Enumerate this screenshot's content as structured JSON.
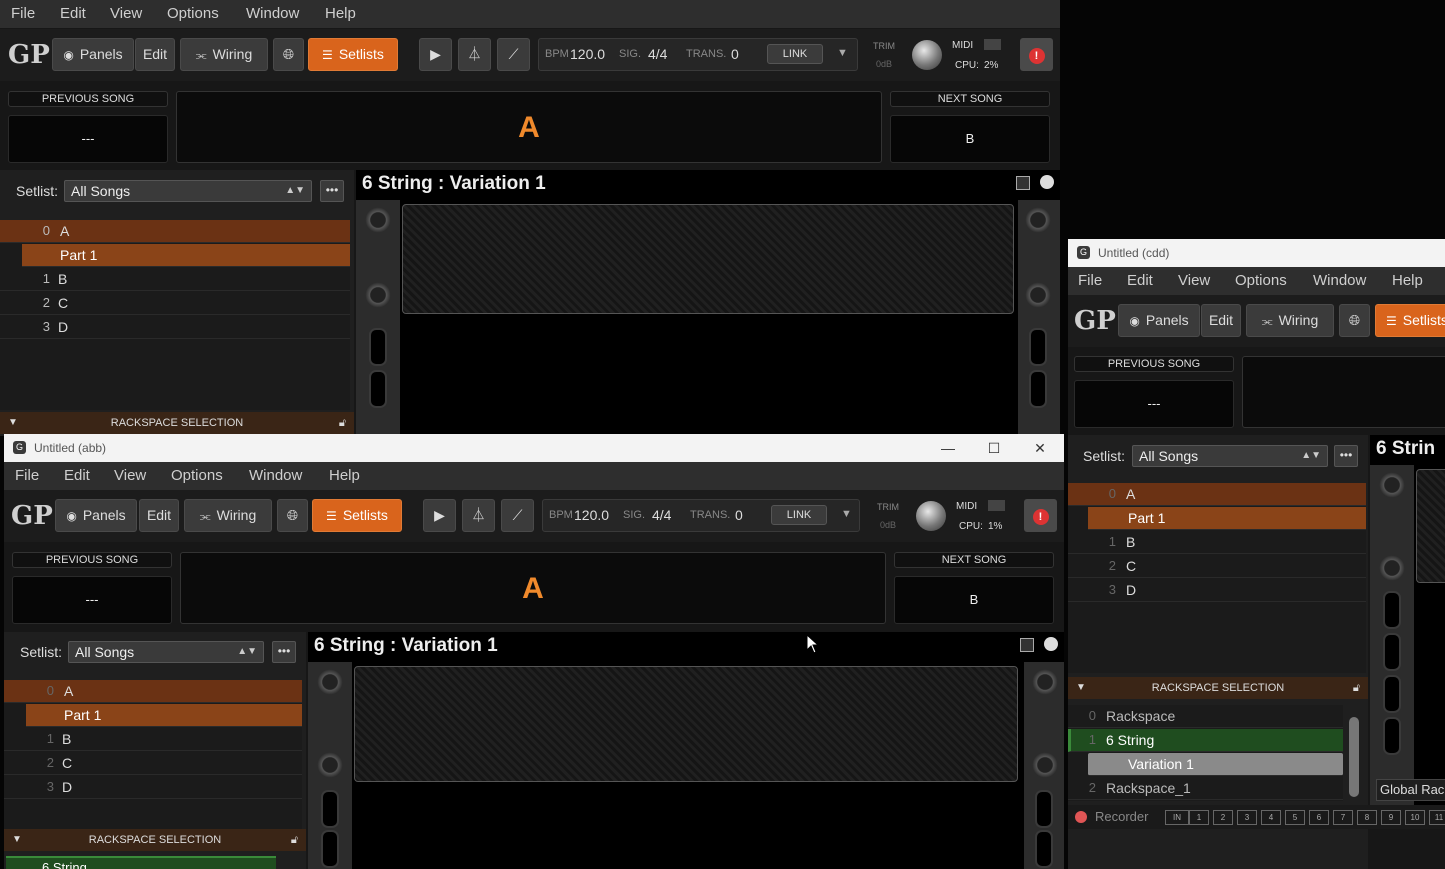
{
  "menu": [
    "File",
    "Edit",
    "View",
    "Options",
    "Window",
    "Help"
  ],
  "toolbar": {
    "logo": "GP",
    "panels": "Panels",
    "edit": "Edit",
    "wiring": "Wiring",
    "setlists": "Setlists",
    "bpm_label": "BPM",
    "bpm": "120.0",
    "sig_label": "SIG.",
    "sig": "4/4",
    "trans_label": "TRANS.",
    "trans": "0",
    "link": "LINK",
    "trim_label": "TRIM",
    "trim_value": "0dB",
    "midi_label": "MIDI",
    "cpu_label": "CPU:"
  },
  "main": {
    "cpu": "2%",
    "previous_song_label": "PREVIOUS SONG",
    "previous_song": "---",
    "current_song": "A",
    "next_song_label": "NEXT SONG",
    "next_song": "B",
    "setlist_label": "Setlist:",
    "setlist_value": "All Songs",
    "songs": [
      {
        "n": "0",
        "name": "A"
      },
      {
        "n": "",
        "name": "Part 1"
      },
      {
        "n": "1",
        "name": "B"
      },
      {
        "n": "2",
        "name": "C"
      },
      {
        "n": "3",
        "name": "D"
      }
    ],
    "rackspace_section": "RACKSPACE SELECTION",
    "rack_title": "6 String : Variation 1"
  },
  "abb": {
    "title": "Untitled (abb)",
    "cpu": "1%",
    "previous_song_label": "PREVIOUS SONG",
    "previous_song": "---",
    "current_song": "A",
    "next_song_label": "NEXT SONG",
    "next_song": "B",
    "setlist_label": "Setlist:",
    "setlist_value": "All Songs",
    "songs": [
      {
        "n": "0",
        "name": "A"
      },
      {
        "n": "",
        "name": "Part 1"
      },
      {
        "n": "1",
        "name": "B"
      },
      {
        "n": "2",
        "name": "C"
      },
      {
        "n": "3",
        "name": "D"
      }
    ],
    "rackspace_section": "RACKSPACE SELECTION",
    "rack_title": "6 String : Variation 1",
    "rackspace_partial": "6 String"
  },
  "cdd": {
    "title": "Untitled (cdd)",
    "previous_song_label": "PREVIOUS SONG",
    "previous_song": "---",
    "setlist_label": "Setlist:",
    "setlist_value": "All Songs",
    "songs": [
      {
        "n": "0",
        "name": "A"
      },
      {
        "n": "",
        "name": "Part 1"
      },
      {
        "n": "1",
        "name": "B"
      },
      {
        "n": "2",
        "name": "C"
      },
      {
        "n": "3",
        "name": "D"
      }
    ],
    "rackspace_section": "RACKSPACE SELECTION",
    "rackspaces": [
      {
        "n": "0",
        "name": "Rackspace"
      },
      {
        "n": "1",
        "name": "6 String"
      },
      {
        "n": "",
        "name": "Variation 1"
      },
      {
        "n": "2",
        "name": "Rackspace_1"
      }
    ],
    "rack_title_partial": "6 Strin",
    "global_rack": "Global Rack",
    "recorder": "Recorder",
    "in_label": "IN",
    "channels": [
      "1",
      "2",
      "3",
      "4",
      "5",
      "6",
      "7",
      "8",
      "9",
      "10",
      "11"
    ]
  },
  "colors": {
    "accent": "#d9641c",
    "song_text": "#f08a2c",
    "part_bg": "#8a4418",
    "green_sel": "#1f4d1f"
  }
}
